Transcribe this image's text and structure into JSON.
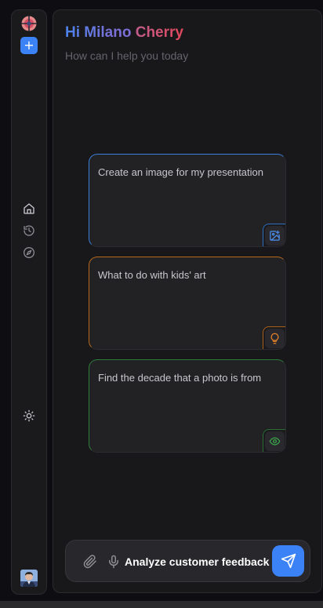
{
  "greeting": {
    "hi": "Hi Milano ",
    "name": "Cherry",
    "subtitle": "How can I help you today"
  },
  "sidebar": {
    "new_chat_label": "+",
    "nav_icons": [
      "home-icon",
      "history-icon",
      "compass-icon"
    ],
    "theme_icon": "sun-icon"
  },
  "cards": [
    {
      "text": "Create an image for my presentation",
      "icon": "image-plus-icon",
      "accent": "#3b7fd8"
    },
    {
      "text": "What to do with kids' art",
      "icon": "lightbulb-icon",
      "accent": "#e0802a"
    },
    {
      "text": "Find the decade that a photo is from",
      "icon": "eye-icon",
      "accent": "#3aa64a"
    }
  ],
  "input": {
    "value": "Analyze customer feedback"
  },
  "colors": {
    "accent": "#3b82f6",
    "background": "#0e0e12",
    "panel": "#18181b"
  }
}
